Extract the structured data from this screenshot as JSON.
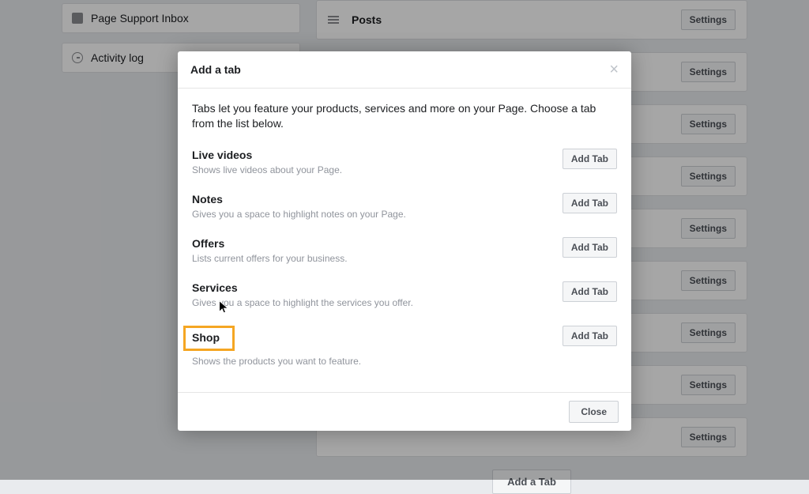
{
  "sidebar": {
    "items": [
      {
        "label": "Page Support Inbox"
      },
      {
        "label": "Activity log"
      }
    ]
  },
  "main": {
    "posts_label": "Posts",
    "settings_label": "Settings",
    "add_tab_label": "Add a Tab"
  },
  "modal": {
    "title": "Add a tab",
    "description": "Tabs let you feature your products, services and more on your Page. Choose a tab from the list below.",
    "add_tab_button": "Add Tab",
    "close_button": "Close",
    "options": [
      {
        "title": "Live videos",
        "desc": "Shows live videos about your Page."
      },
      {
        "title": "Notes",
        "desc": "Gives you a space to highlight notes on your Page."
      },
      {
        "title": "Offers",
        "desc": "Lists current offers for your business."
      },
      {
        "title": "Services",
        "desc": "Gives you a space to highlight the services you offer."
      },
      {
        "title": "Shop",
        "desc": "Shows the products you want to feature."
      }
    ]
  }
}
